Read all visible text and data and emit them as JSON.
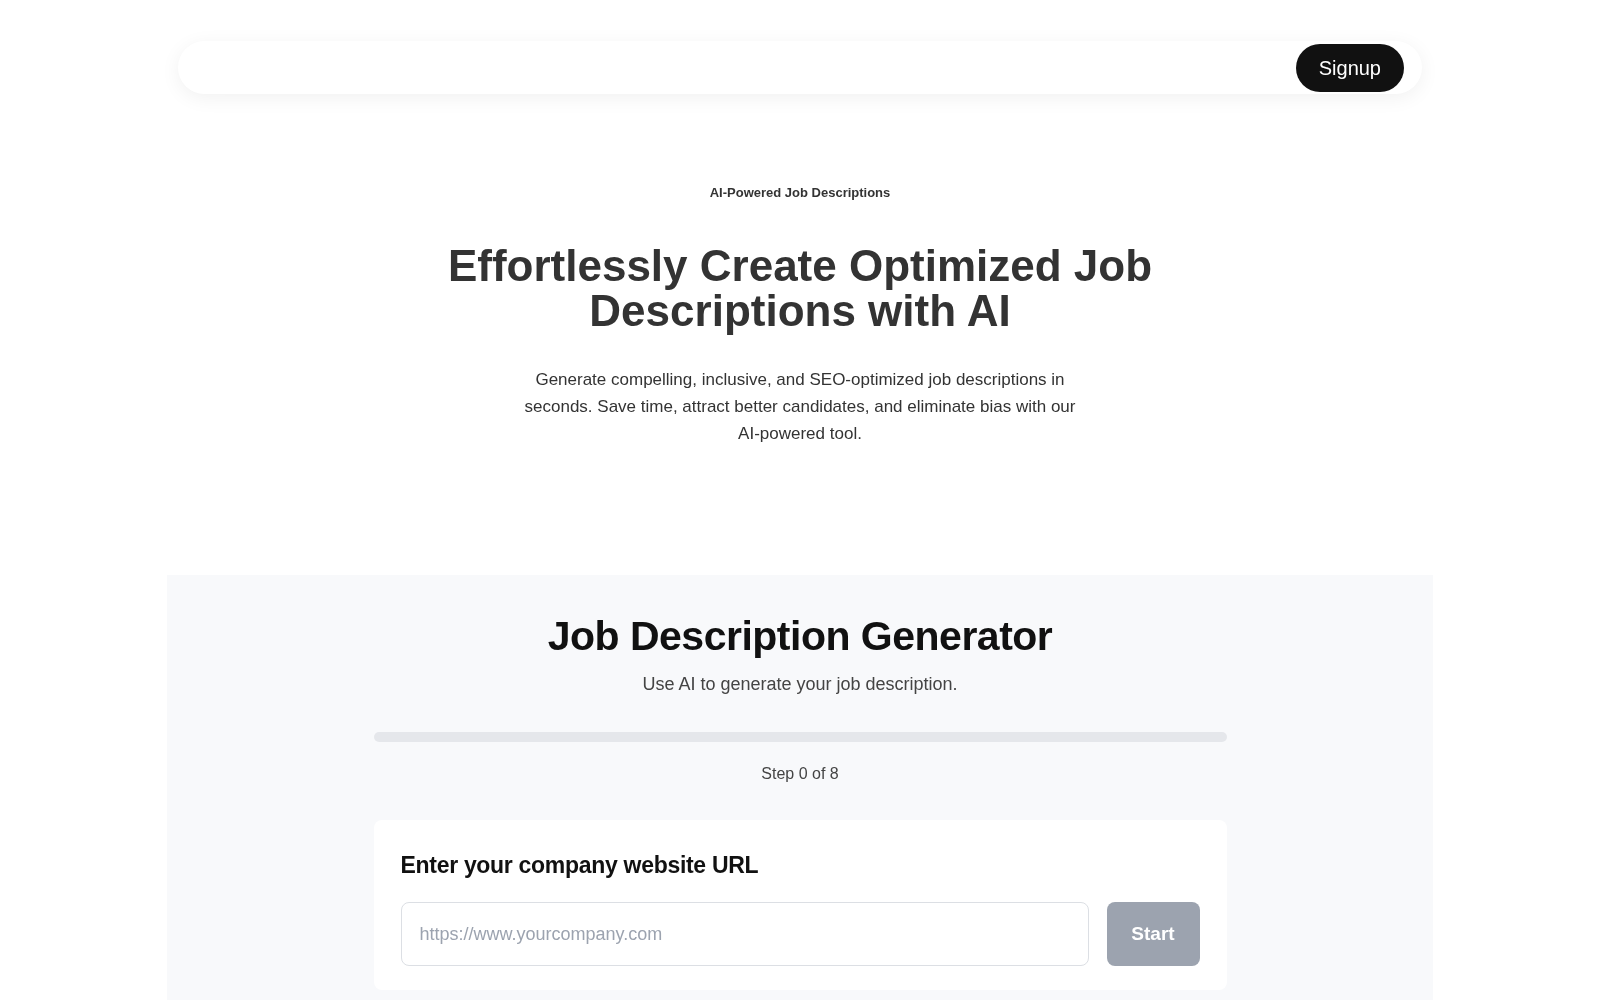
{
  "nav": {
    "signup_button": "Signup"
  },
  "hero": {
    "eyebrow": "AI-Powered Job Descriptions",
    "title": "Effortlessly Create Optimized Job Descriptions with AI",
    "description": "Generate compelling, inclusive, and SEO-optimized job descriptions in seconds. Save time, attract better candidates, and eliminate bias with our AI-powered tool."
  },
  "generator": {
    "title": "Job Description Generator",
    "subtitle": "Use AI to generate your job description.",
    "progress": {
      "level": 0
    },
    "step_label": "Step 0 of 8",
    "card": {
      "title": "Enter your company website URL",
      "url_field": {
        "placeholder": "https://www.yourcompany.com"
      },
      "start_button": {
        "label": "Start",
        "disabled": true
      }
    }
  }
}
